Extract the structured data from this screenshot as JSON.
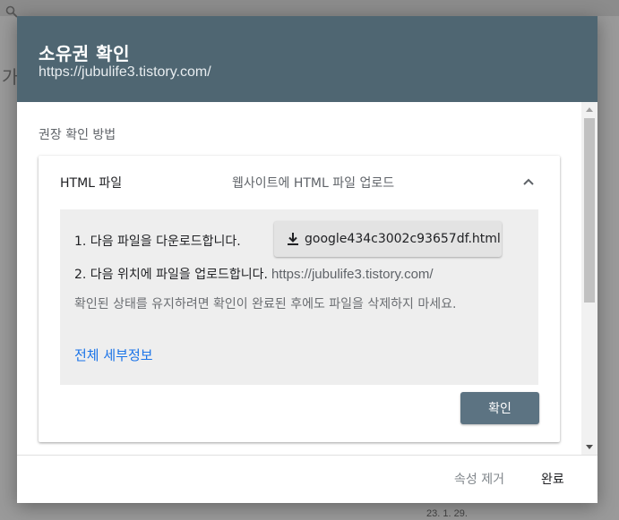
{
  "background": {
    "left_partial_text": "가",
    "bottom_partial_text": "23. 1. 29."
  },
  "dialog": {
    "title": "소유권 확인",
    "subtitle": "https://jubulife3.tistory.com/",
    "header_color": "#4f6672",
    "section_label": "권장 확인 방법",
    "method": {
      "title": "HTML 파일",
      "description": "웹사이트에 HTML 파일 업로드",
      "expanded": true,
      "step1_text": "1. 다음 파일을 다운로드합니다.",
      "download_file": "google434c3002c93657df.html",
      "step2_text": "2. 다음 위치에 파일을 업로드합니다.",
      "step2_url": "https://jubulife3.tistory.com/",
      "note": "확인된 상태를 유지하려면 확인이 완료된 후에도 파일을 삭제하지 마세요.",
      "details_link": "전체 세부정보",
      "confirm_button": "확인"
    },
    "footer": {
      "remove_button": "속성 제거",
      "done_button": "완료"
    }
  },
  "colors": {
    "link": "#1a73e8",
    "confirm_button": "#5c7382"
  }
}
